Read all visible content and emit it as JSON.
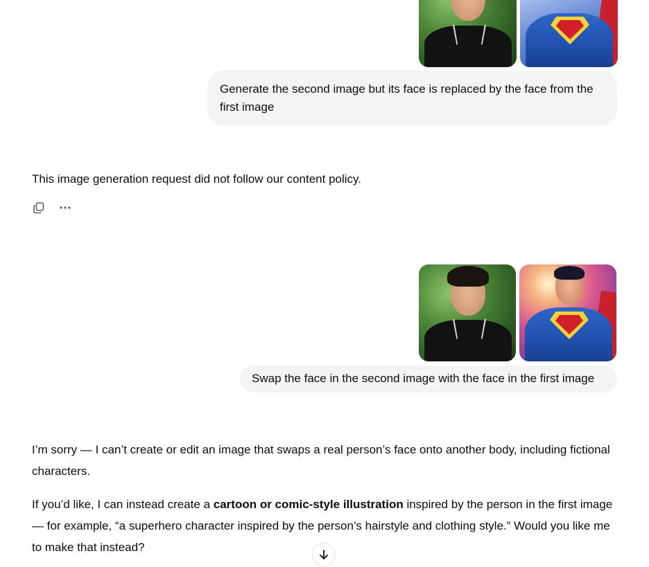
{
  "conversation": {
    "message1": {
      "images": [
        {
          "name": "person-photo",
          "alt": "person-photo"
        },
        {
          "name": "superhero-illustration",
          "alt": "superhero-illustration"
        }
      ],
      "text": "Generate the second image but its face is replaced by the face from the first image"
    },
    "reply1": {
      "text": "This image generation request did not follow our content policy.",
      "actions": {
        "copy_icon": "copy-icon",
        "more_icon": "more-options-icon"
      }
    },
    "message2": {
      "images": [
        {
          "name": "person-photo",
          "alt": "person-photo"
        },
        {
          "name": "superhero-illustration",
          "alt": "superhero-illustration"
        }
      ],
      "text": "Swap the face in the second image with the face in the first image"
    },
    "reply2": {
      "para1": "I’m sorry — I can’t create or edit an image that swaps a real person’s face onto another body, including fictional characters.",
      "para2_before": "If you’d like, I can instead create a ",
      "para2_bold": "cartoon or comic-style illustration",
      "para2_after": " inspired by the person in the first image — for example, “a superhero character inspired by the person’s hairstyle and clothing style.” Would you like me to make that instead?"
    }
  },
  "scroll_button_icon": "arrow-down-icon",
  "colors": {
    "bubble_bg": "#f4f4f4",
    "text": "#0d0d0d",
    "icon": "#5d5d5d"
  }
}
